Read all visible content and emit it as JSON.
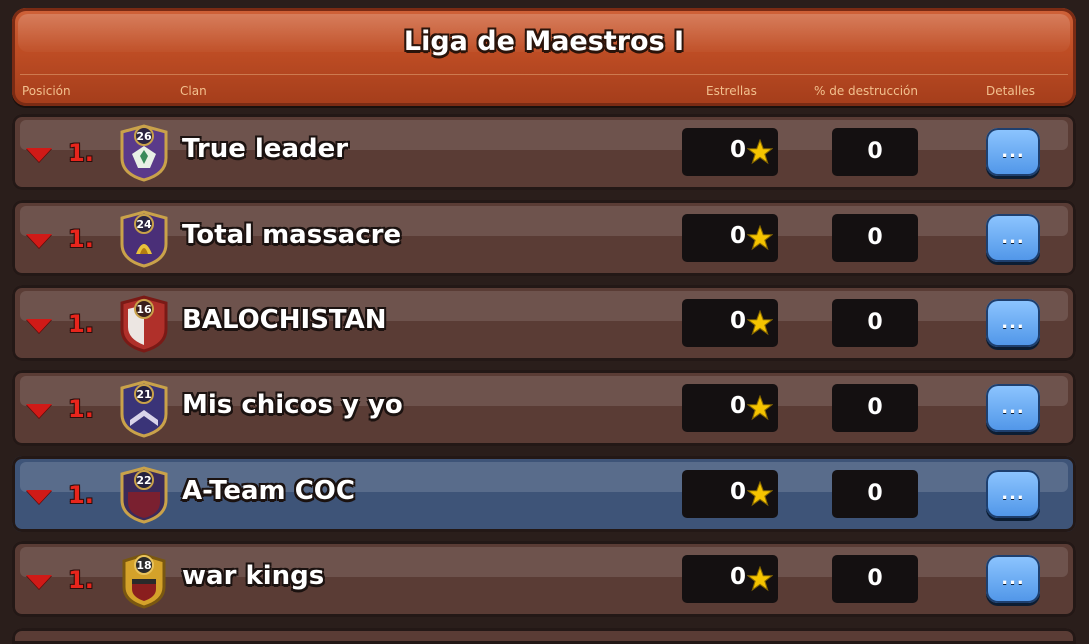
{
  "header": {
    "title": "Liga de Maestros I",
    "columns": {
      "position": "Posición",
      "clan": "Clan",
      "stars": "Estrellas",
      "destruction": "% de destrucción",
      "details": "Detalles"
    }
  },
  "icons": {
    "rank_arrow": "down-arrow-icon",
    "star": "star-icon",
    "details": "ellipsis-icon"
  },
  "colors": {
    "header": "#c04e25",
    "row": "#5a3c35",
    "highlight_row": "#3e5478",
    "rank": "#e8251c",
    "details_button": "#5fa3f0",
    "star": "#f5c400"
  },
  "rows": [
    {
      "rank": "1.",
      "badge_level": "26",
      "name": "True leader",
      "stars": "0",
      "destruction": "0",
      "details": "..."
    },
    {
      "rank": "1.",
      "badge_level": "24",
      "name": "Total massacre",
      "stars": "0",
      "destruction": "0",
      "details": "..."
    },
    {
      "rank": "1.",
      "badge_level": "16",
      "name": "BALOCHISTAN",
      "stars": "0",
      "destruction": "0",
      "details": "..."
    },
    {
      "rank": "1.",
      "badge_level": "21",
      "name": "Mis chicos y yo",
      "stars": "0",
      "destruction": "0",
      "details": "..."
    },
    {
      "rank": "1.",
      "badge_level": "22",
      "name": "A-Team COC",
      "stars": "0",
      "destruction": "0",
      "details": "...",
      "highlighted": true
    },
    {
      "rank": "1.",
      "badge_level": "18",
      "name": "war kings",
      "stars": "0",
      "destruction": "0",
      "details": "..."
    }
  ]
}
